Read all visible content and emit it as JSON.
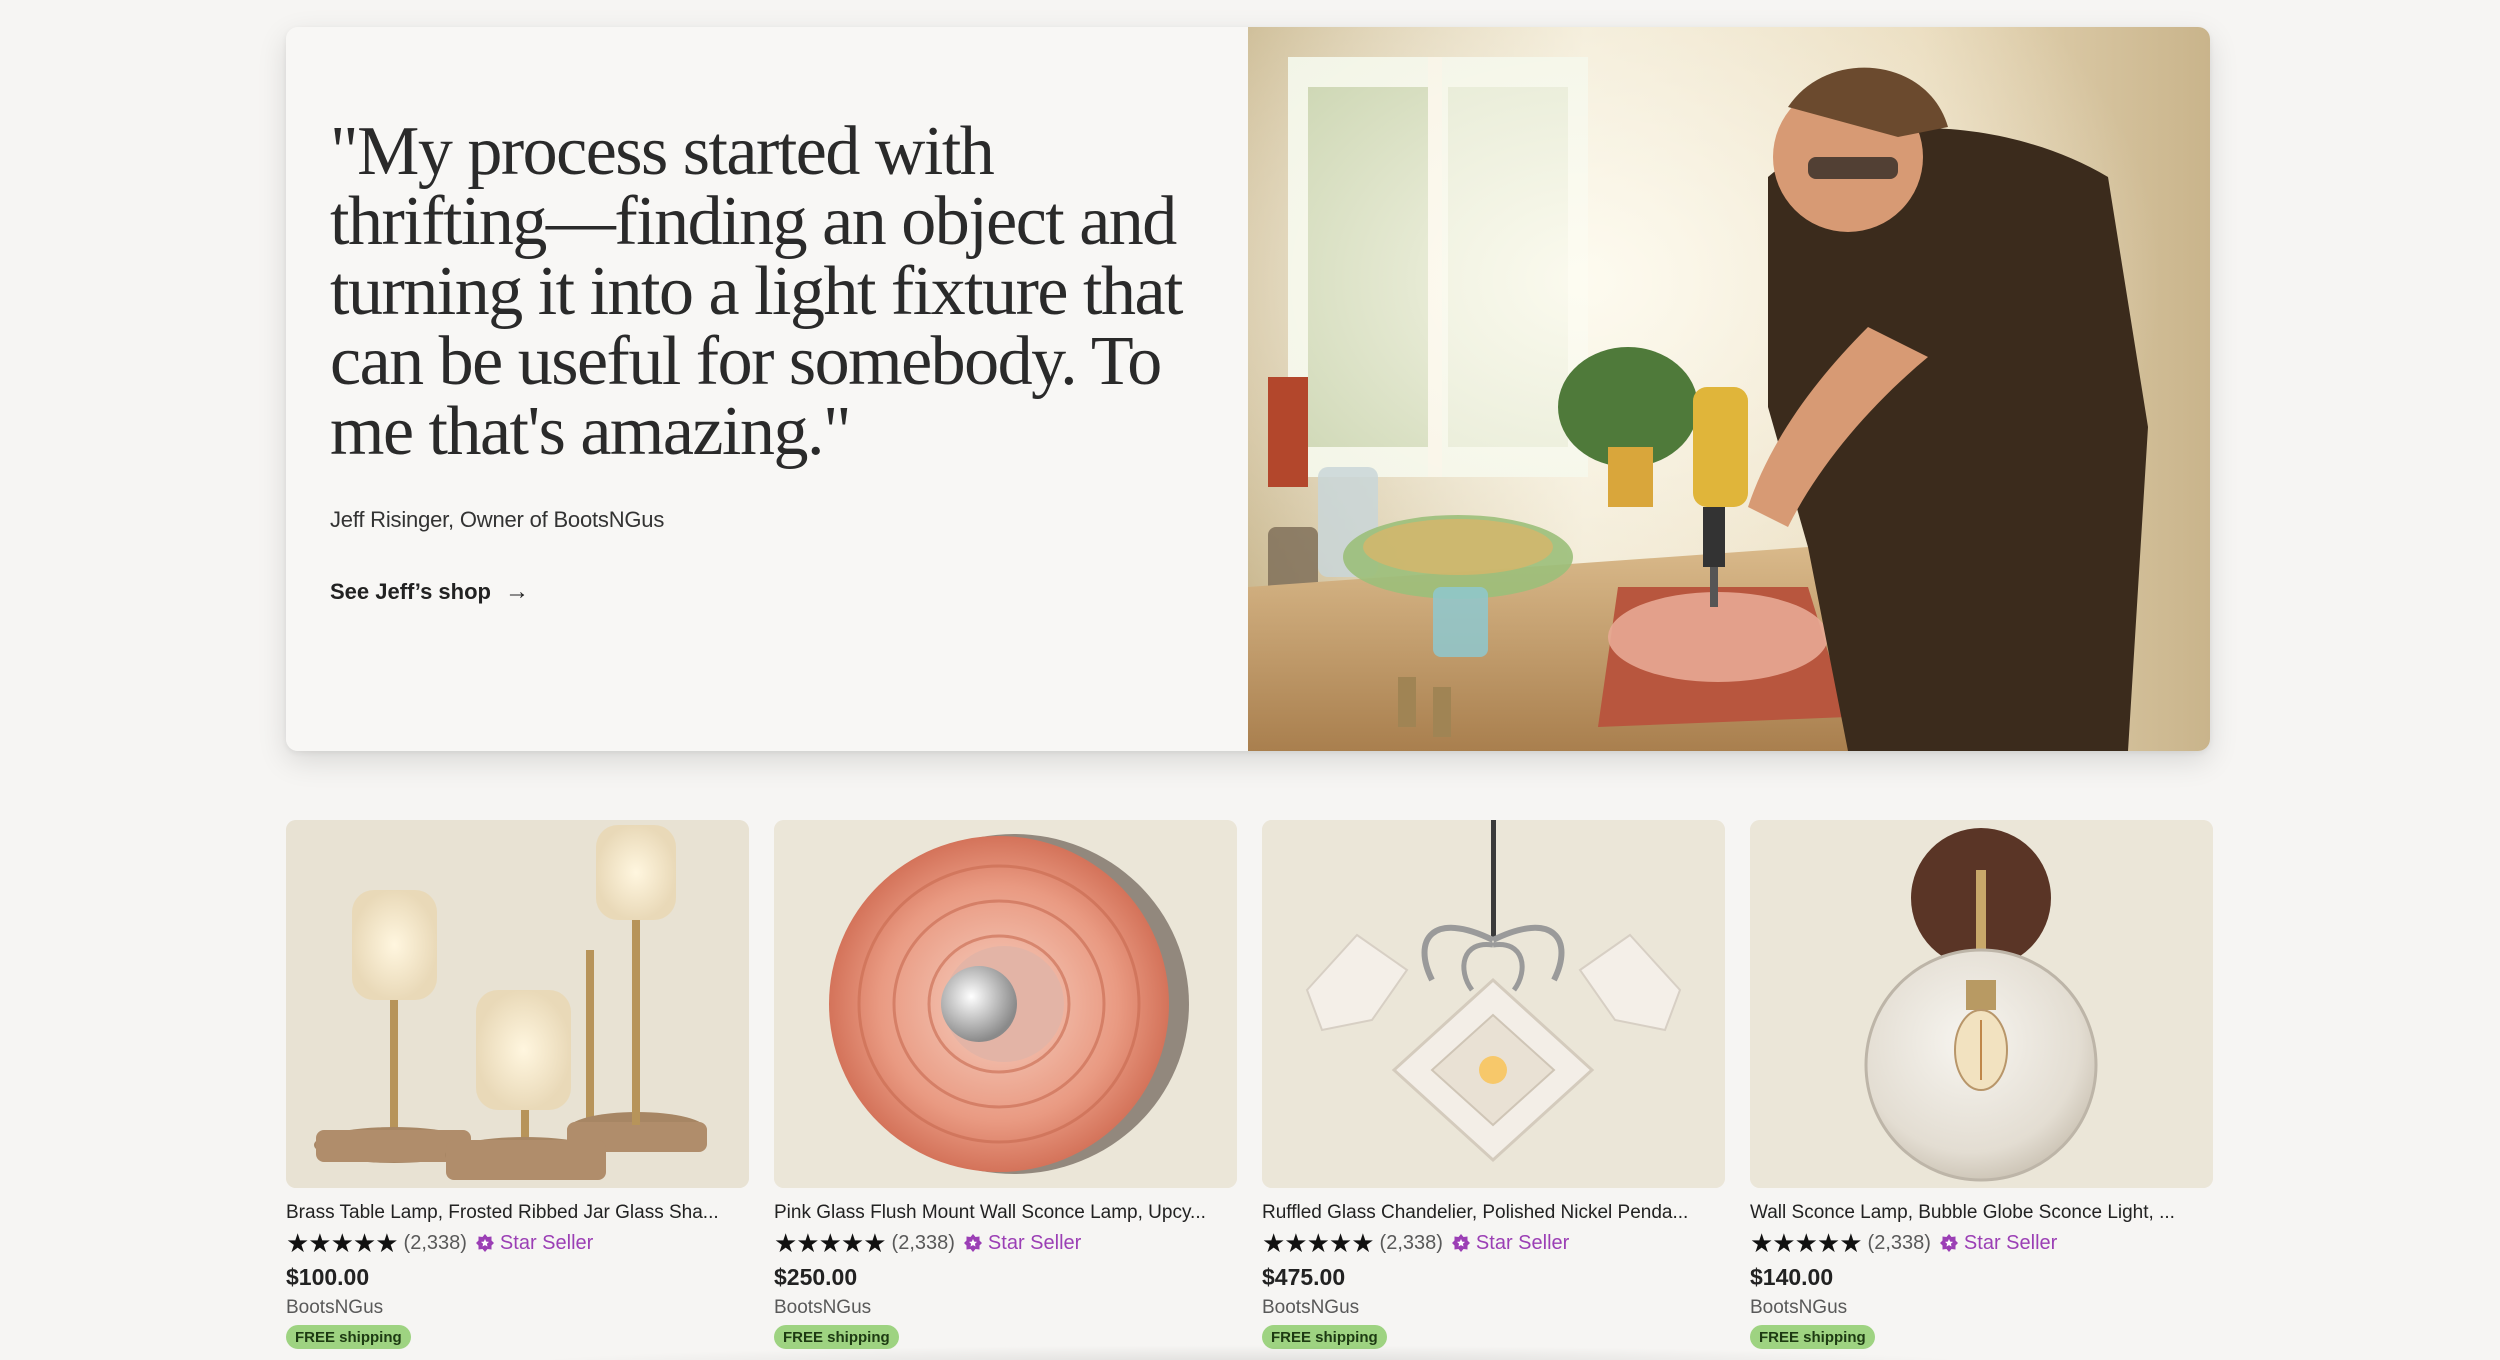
{
  "feature": {
    "quote": "\"My process started with thrifting—finding an object and turning it into a light fixture that can be useful for somebody. To me that's amazing.\"",
    "attribution": "Jeff Risinger, Owner of BootsNGus",
    "cta_label": "See Jeff’s shop",
    "cta_icon": "arrow-right-icon",
    "cta_arrow": "→",
    "photo_icon": "artisan-drilling-glass-photo"
  },
  "listings": [
    {
      "title": "Brass Table Lamp, Frosted Ribbed Jar Glass Sha...",
      "stars": "★★★★★",
      "rating": 5,
      "reviews": "(2,338)",
      "badge": "Star Seller",
      "price": "$100.00",
      "shop": "BootsNGus",
      "shipping": "FREE shipping"
    },
    {
      "title": "Pink Glass Flush Mount Wall Sconce Lamp, Upcy...",
      "stars": "★★★★★",
      "rating": 5,
      "reviews": "(2,338)",
      "badge": "Star Seller",
      "price": "$250.00",
      "shop": "BootsNGus",
      "shipping": "FREE shipping"
    },
    {
      "title": "Ruffled Glass Chandelier, Polished Nickel Penda...",
      "stars": "★★★★★",
      "rating": 5,
      "reviews": "(2,338)",
      "badge": "Star Seller",
      "price": "$475.00",
      "shop": "BootsNGus",
      "shipping": "FREE shipping"
    },
    {
      "title": "Wall Sconce Lamp, Bubble Globe Sconce Light, ...",
      "stars": "★★★★★",
      "rating": 5,
      "reviews": "(2,338)",
      "badge": "Star Seller",
      "price": "$140.00",
      "shop": "BootsNGus",
      "shipping": "FREE shipping"
    }
  ],
  "colors": {
    "star_seller": "#9b3fb5",
    "free_shipping_bg": "#9ed381",
    "page_bg": "#f6f5f3"
  }
}
